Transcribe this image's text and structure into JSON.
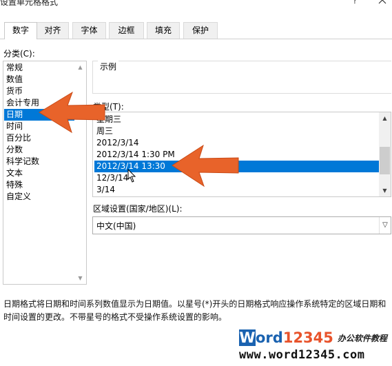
{
  "dialog": {
    "title": "设置单元格格式",
    "help": "?"
  },
  "tabs": [
    {
      "label": "数字",
      "active": true
    },
    {
      "label": "对齐"
    },
    {
      "label": "字体"
    },
    {
      "label": "边框"
    },
    {
      "label": "填充"
    },
    {
      "label": "保护"
    }
  ],
  "category": {
    "label": "分类(C):",
    "selected": "日期",
    "items": [
      "常规",
      "数值",
      "货币",
      "会计专用",
      "日期",
      "时间",
      "百分比",
      "分数",
      "科学记数",
      "文本",
      "特殊",
      "自定义"
    ]
  },
  "sample": {
    "label": "示例",
    "value": ""
  },
  "type": {
    "label": "类型(T):",
    "selected": "2012/3/14 13:30",
    "items": [
      "星期三",
      "周三",
      "2012/3/14",
      "2012/3/14 1:30 PM",
      "2012/3/14 13:30",
      "12/3/14",
      "3/14"
    ]
  },
  "locale": {
    "label": "区域设置(国家/地区)(L):",
    "value": "中文(中国)"
  },
  "description": "日期格式将日期和时间系列数值显示为日期值。以星号(*)开头的日期格式响应操作系统特定的区域日期和时间设置的更改。不带星号的格式不受操作系统设置的影响。",
  "watermark": {
    "brand_w": "W",
    "brand_ord": "ord",
    "brand_num": "12345",
    "tagline": "办公软件教程",
    "url": "www.word12345.com"
  },
  "annotations": {
    "arrow_color": "#e8632a",
    "selection_color": "#0078d7"
  }
}
